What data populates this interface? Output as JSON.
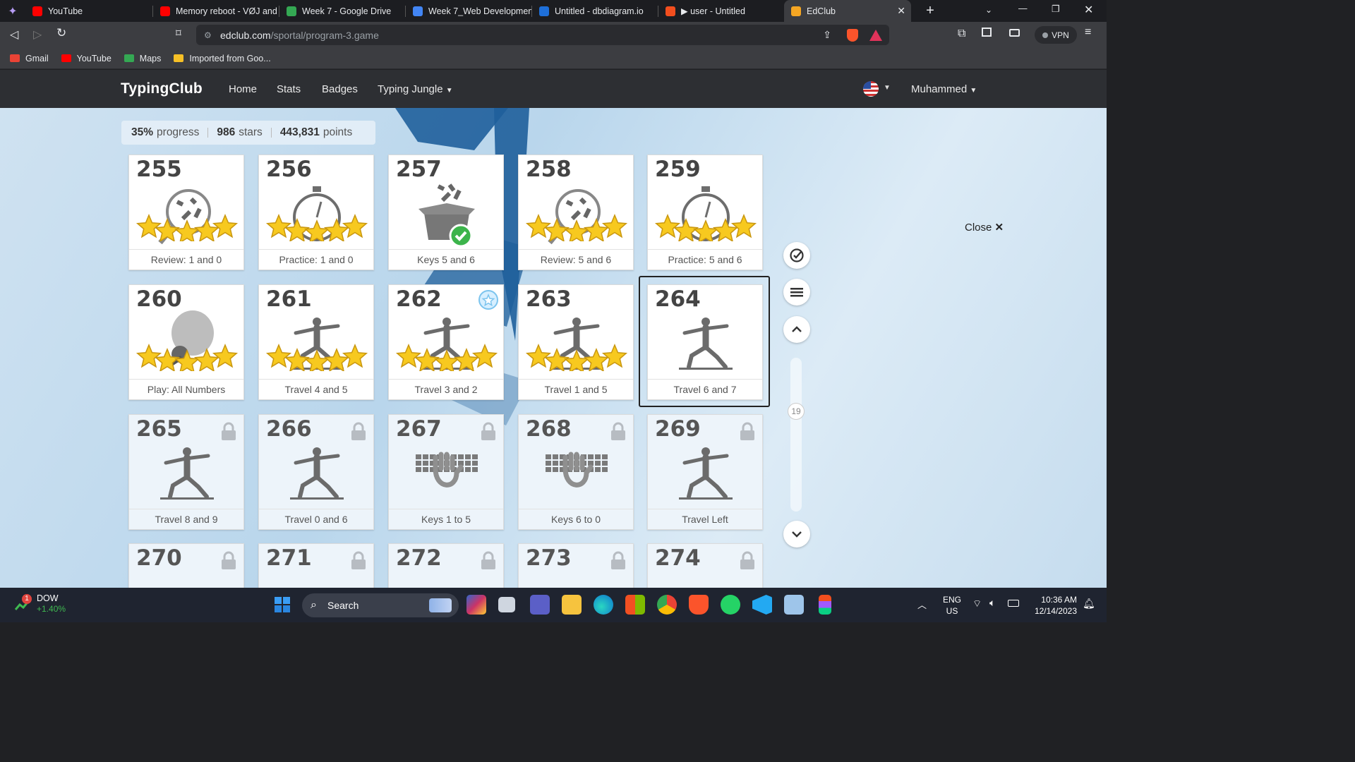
{
  "browser": {
    "tabs": [
      {
        "label": "YouTube",
        "color": "#ff0000"
      },
      {
        "label": "Memory reboot - VØJ and",
        "color": "#ff0000"
      },
      {
        "label": "Week 7 - Google Drive",
        "color": "#34a853"
      },
      {
        "label": "Week 7_Web Developmen",
        "color": "#4285f4"
      },
      {
        "label": "Untitled - dbdiagram.io",
        "color": "#1e6fd9"
      },
      {
        "label": "▶ user - Untitled",
        "color": "#f24e1e"
      },
      {
        "label": "EdClub",
        "color": "#f5a623",
        "active": true
      }
    ],
    "url_host": "edclub.com",
    "url_path": "/sportal/program-3.game",
    "vpn_label": "VPN",
    "bookmarks": [
      {
        "label": "Gmail",
        "color": "#ea4335"
      },
      {
        "label": "YouTube",
        "color": "#ff0000"
      },
      {
        "label": "Maps",
        "color": "#34a853"
      },
      {
        "label": "Imported from Goo...",
        "color": "#f6c026"
      }
    ]
  },
  "navbar": {
    "brand": "TypingClub",
    "links": [
      "Home",
      "Stats",
      "Badges",
      "Typing Jungle"
    ],
    "user": "Muhammed"
  },
  "stats": {
    "progress": "35%",
    "progress_label": "progress",
    "stars": "986",
    "stars_label": "stars",
    "points": "443,831",
    "points_label": "points"
  },
  "lessons": [
    {
      "num": "255",
      "label": "Review: 1 and 0",
      "icon": "magnifier-numbers",
      "stars": 5,
      "locked": false
    },
    {
      "num": "256",
      "label": "Practice: 1 and 0",
      "icon": "stopwatch",
      "stars": 5,
      "locked": false
    },
    {
      "num": "257",
      "label": "Keys 5 and 6",
      "icon": "box-numbers-check",
      "stars": 0,
      "locked": false
    },
    {
      "num": "258",
      "label": "Review: 5 and 6",
      "icon": "magnifier-numbers",
      "stars": 5,
      "locked": false
    },
    {
      "num": "259",
      "label": "Practice: 5 and 6",
      "icon": "stopwatch",
      "stars": 5,
      "locked": false
    },
    {
      "num": "260",
      "label": "Play: All Numbers",
      "icon": "balloon-game",
      "stars": 5,
      "locked": false
    },
    {
      "num": "261",
      "label": "Travel 4 and 5",
      "icon": "yoga-pose",
      "stars": 5,
      "locked": false
    },
    {
      "num": "262",
      "label": "Travel 3 and 2",
      "icon": "yoga-pose",
      "stars": 5,
      "locked": false,
      "badge": true
    },
    {
      "num": "263",
      "label": "Travel 1 and 5",
      "icon": "yoga-pose",
      "stars": 5,
      "locked": false
    },
    {
      "num": "264",
      "label": "Travel 6 and 7",
      "icon": "yoga-pose",
      "stars": 0,
      "locked": false,
      "selected": true
    },
    {
      "num": "265",
      "label": "Travel 8 and 9",
      "icon": "yoga-pose",
      "stars": 0,
      "locked": true
    },
    {
      "num": "266",
      "label": "Travel 0 and 6",
      "icon": "yoga-pose",
      "stars": 0,
      "locked": true
    },
    {
      "num": "267",
      "label": "Keys 1 to 5",
      "icon": "keyboard-hand",
      "stars": 0,
      "locked": true
    },
    {
      "num": "268",
      "label": "Keys 6 to 0",
      "icon": "keyboard-hand",
      "stars": 0,
      "locked": true
    },
    {
      "num": "269",
      "label": "Travel Left",
      "icon": "yoga-pose",
      "stars": 0,
      "locked": true
    },
    {
      "num": "270",
      "label": "",
      "icon": "",
      "stars": 0,
      "locked": true
    },
    {
      "num": "271",
      "label": "",
      "icon": "",
      "stars": 0,
      "locked": true
    },
    {
      "num": "272",
      "label": "",
      "icon": "",
      "stars": 0,
      "locked": true
    },
    {
      "num": "273",
      "label": "",
      "icon": "",
      "stars": 0,
      "locked": true
    },
    {
      "num": "274",
      "label": "",
      "icon": "",
      "stars": 0,
      "locked": true
    }
  ],
  "side": {
    "page": "19",
    "close_label": "Close"
  },
  "taskbar": {
    "ticker": "DOW",
    "ticker_change": "+1.40%",
    "ticker_badge": "1",
    "search_label": "Search",
    "lang": "ENG",
    "region": "US",
    "time": "10:36 AM",
    "date": "12/14/2023"
  }
}
